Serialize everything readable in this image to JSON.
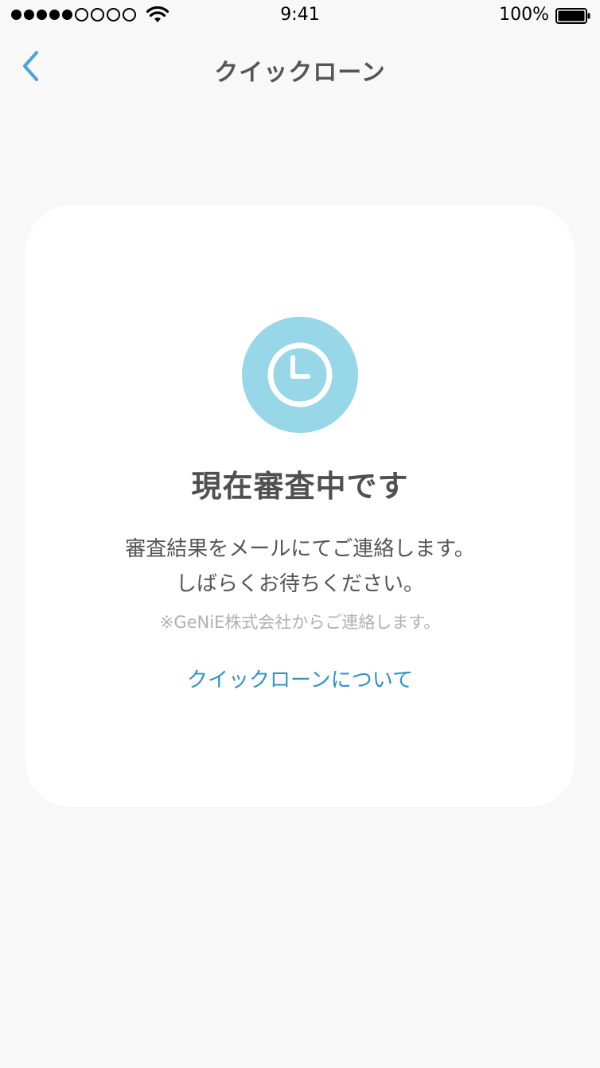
{
  "status_bar": {
    "time": "9:41",
    "battery_percent": "100%",
    "signal_filled": 5,
    "signal_empty": 4
  },
  "nav": {
    "title": "クイックローン",
    "back_icon": "chevron-left-icon"
  },
  "card": {
    "icon": "clock-icon",
    "title": "現在審査中です",
    "message_line1": "審査結果をメールにてご連絡します。",
    "message_line2": "しばらくお待ちください。",
    "note": "※GeNiE株式会社からご連絡します。",
    "link": "クイックローンについて"
  },
  "colors": {
    "background": "#f8f8f8",
    "card": "#ffffff",
    "accent": "#2f93c4",
    "badge": "#98d7e8",
    "back_chevron": "#4aa3d6"
  }
}
